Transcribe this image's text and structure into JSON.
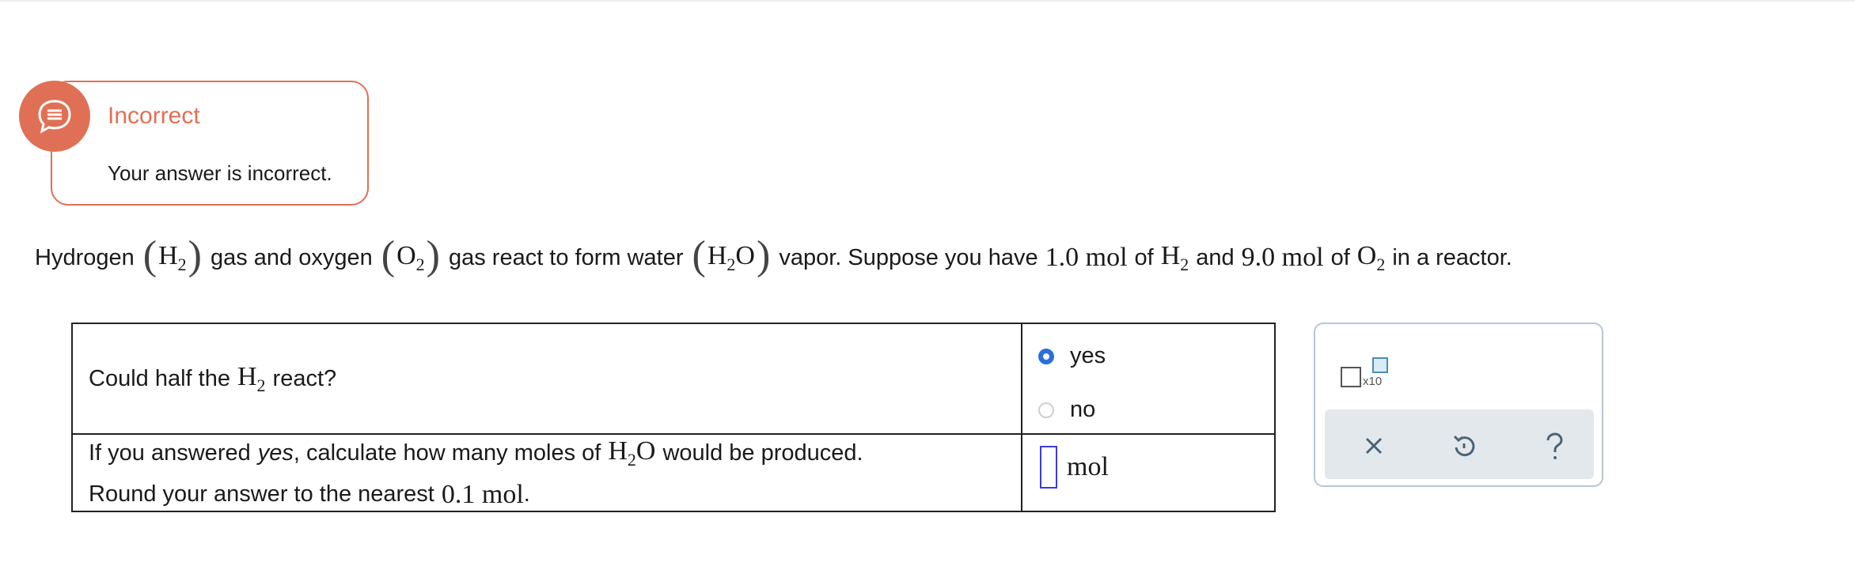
{
  "feedback": {
    "status": "Incorrect",
    "message": "Your answer is incorrect.",
    "icon": "chat-bubble-icon",
    "color": "#e07055"
  },
  "problem": {
    "t1": "Hydrogen",
    "h2": "H",
    "h2_sub": "2",
    "t2": "gas and oxygen",
    "o2": "O",
    "o2_sub": "2",
    "t3": "gas react to form water",
    "h2o_h": "H",
    "h2o_sub": "2",
    "h2o_o": "O",
    "t4": "vapor. Suppose you have",
    "amt1": "1.0 mol",
    "t5": "of",
    "h2b": "H",
    "h2b_sub": "2",
    "t6": "and",
    "amt2": "9.0 mol",
    "t7": "of",
    "o2b": "O",
    "o2b_sub": "2",
    "t8": "in a reactor."
  },
  "question1": {
    "pre": "Could half the",
    "chem": "H",
    "chem_sub": "2",
    "post": "react?",
    "options": [
      {
        "label": "yes",
        "selected": true
      },
      {
        "label": "no",
        "selected": false
      }
    ]
  },
  "question2": {
    "pre": "If you answered",
    "em": "yes",
    "mid": ", calculate how many moles of",
    "chem_h": "H",
    "chem_sub": "2",
    "chem_o": "O",
    "post": "would be produced.",
    "round_text": "Round your answer to the nearest",
    "round_value": "0.1 mol",
    "round_end": ".",
    "input_value": "",
    "unit": "mol"
  },
  "tools": {
    "x10_label": "x10",
    "clear_icon": "close-icon",
    "undo_icon": "undo-icon",
    "help_icon": "help-icon"
  },
  "colors": {
    "accent": "#2a6fdb",
    "error": "#e07055",
    "panel_border": "#b8c6d4"
  }
}
